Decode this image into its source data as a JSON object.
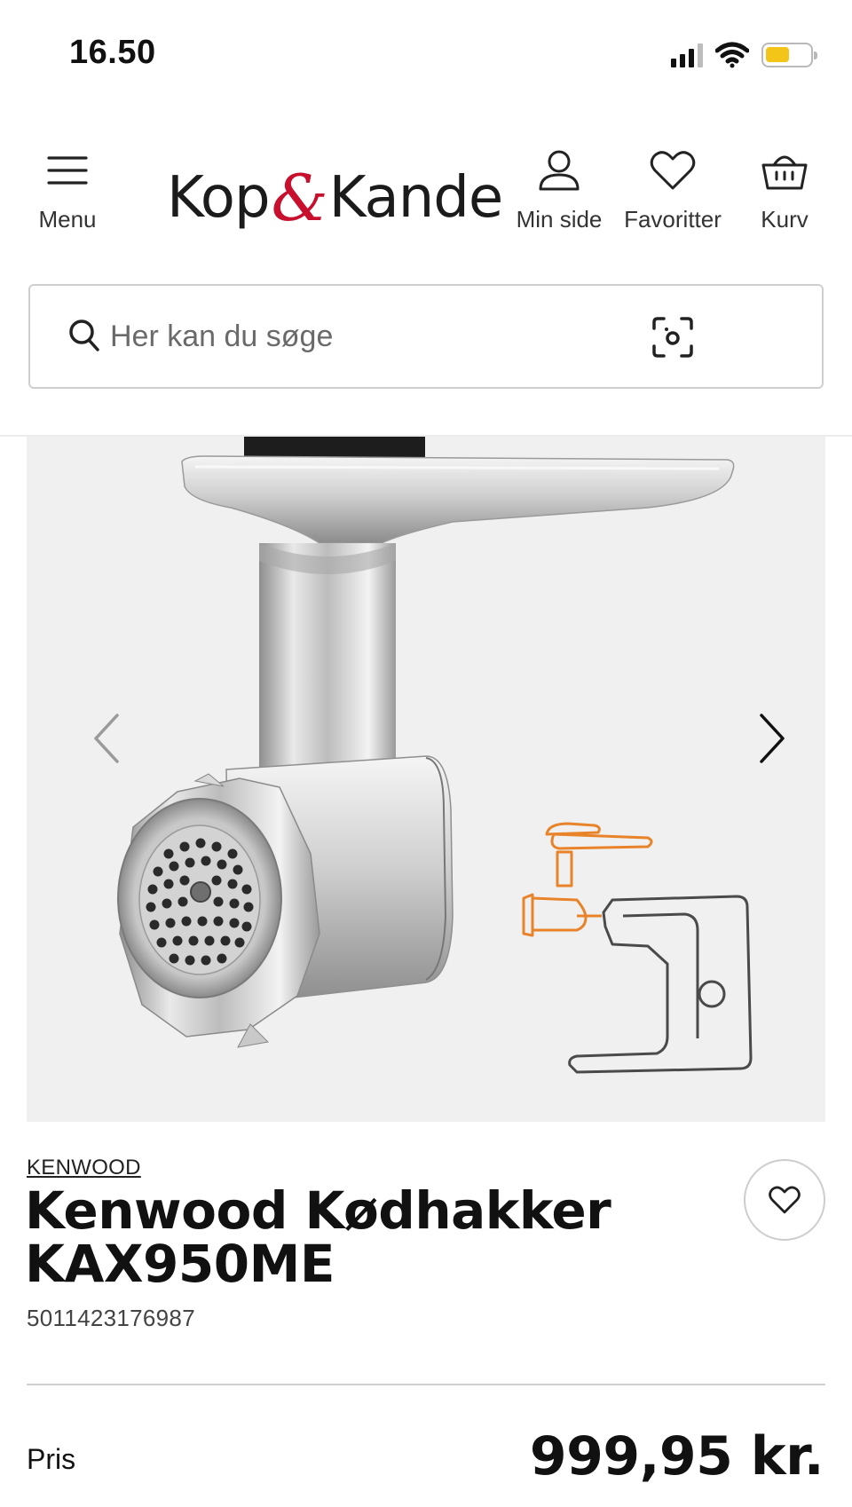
{
  "status_bar": {
    "time": "16.50",
    "icons": [
      "cellular-signal-icon",
      "wifi-icon",
      "battery-icon"
    ],
    "battery_color": "#f2c518"
  },
  "header": {
    "menu_label": "Menu",
    "logo_text_left": "Kop",
    "logo_ampersand": "&",
    "logo_text_right": "Kande",
    "logo_accent_color": "#c8102e",
    "account_label": "Min side",
    "favorites_label": "Favoritter",
    "cart_label": "Kurv"
  },
  "search": {
    "placeholder": "Her kan du søge",
    "value": ""
  },
  "product": {
    "brand": "KENWOOD",
    "title_line1": "Kenwood Kødhakker",
    "title_line2": "KAX950ME",
    "ean": "5011423176987",
    "price_label": "Pris",
    "price": "999,95 kr.",
    "image_alt_icon": "meat-grinder-attachment",
    "diagram_accent_color": "#e8832a"
  }
}
